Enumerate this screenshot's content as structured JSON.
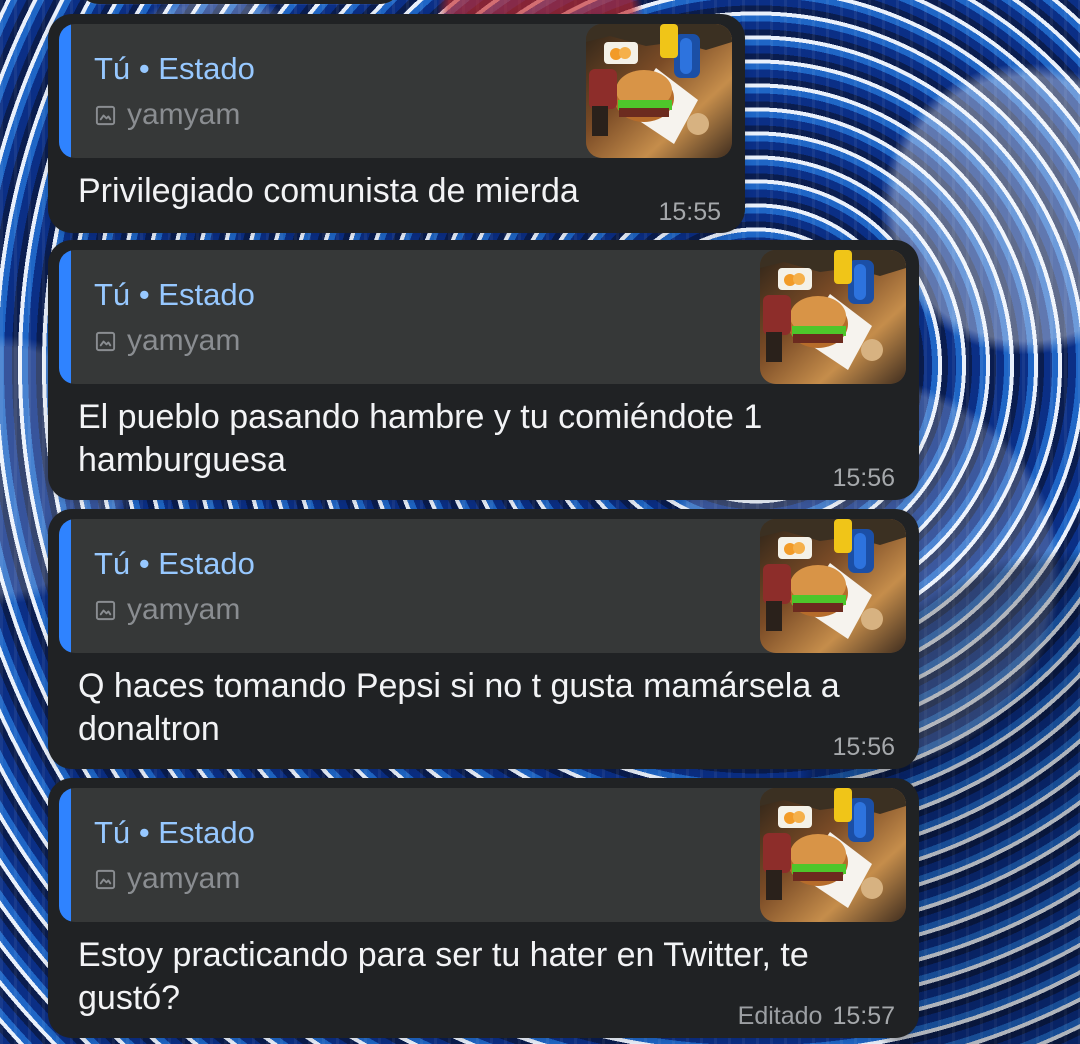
{
  "messages": [
    {
      "reply": {
        "sender": "Tú",
        "separator": "•",
        "context": "Estado",
        "media_label": "yamyam",
        "media_icon": "image-icon"
      },
      "text": "Privilegiado comunista de mierda",
      "time": "15:55",
      "edited": ""
    },
    {
      "reply": {
        "sender": "Tú",
        "separator": "•",
        "context": "Estado",
        "media_label": "yamyam",
        "media_icon": "image-icon"
      },
      "text": "El pueblo pasando hambre y tu comiéndote 1\nhamburguesa",
      "time": "15:56",
      "edited": ""
    },
    {
      "reply": {
        "sender": "Tú",
        "separator": "•",
        "context": "Estado",
        "media_label": "yamyam",
        "media_icon": "image-icon"
      },
      "text": "Q haces tomando Pepsi si no t gusta mamársela a\ndonaltron",
      "time": "15:56",
      "edited": ""
    },
    {
      "reply": {
        "sender": "Tú",
        "separator": "•",
        "context": "Estado",
        "media_label": "yamyam",
        "media_icon": "image-icon"
      },
      "text": "Estoy practicando para ser tu hater en Twitter, te\ngustó?",
      "time": "15:57",
      "edited": "Editado"
    }
  ],
  "colors": {
    "bubble": "#202224",
    "reply_panel": "#363838",
    "accent": "#2f83ff",
    "reply_title": "#97c8ff",
    "text": "#f2f3f5",
    "meta": "#a5a8ab"
  }
}
